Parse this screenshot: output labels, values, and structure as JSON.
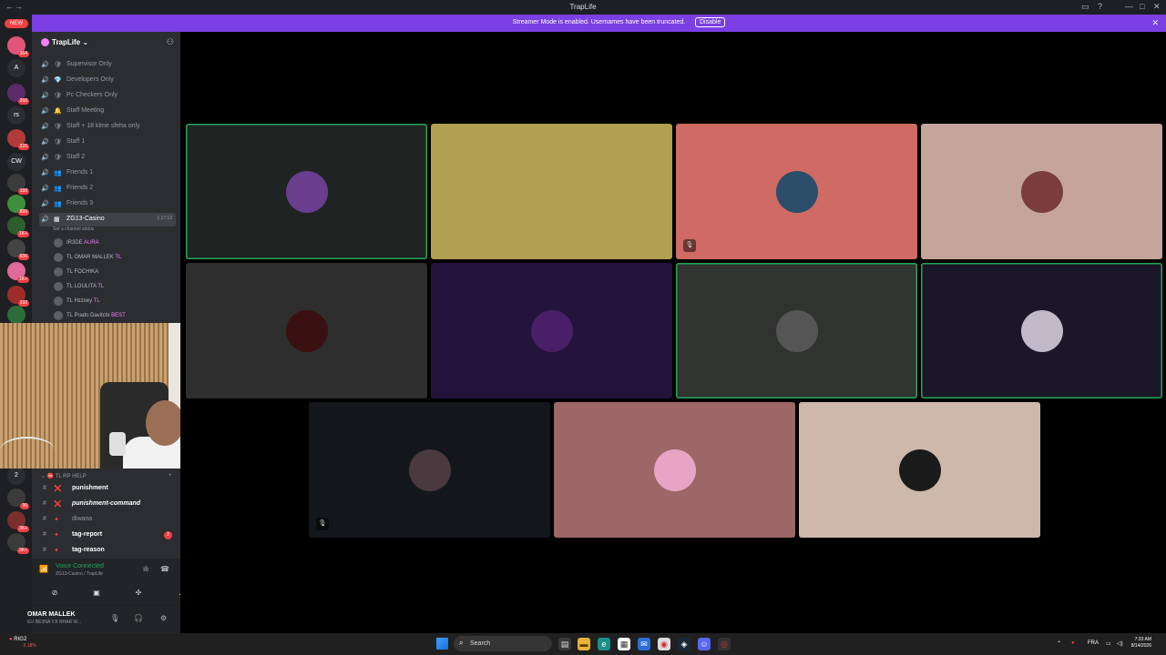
{
  "window": {
    "title": "TrapLife"
  },
  "streamer_banner": {
    "message": "Streamer Mode is enabled. Usernames have been truncated.",
    "disable_label": "Disable"
  },
  "servers": {
    "new_label": "NEW",
    "items": [
      {
        "label": "",
        "badge": "364",
        "color": "#e2547a"
      },
      {
        "label": "A",
        "badge": "",
        "color": "#2b2d31"
      },
      {
        "label": "",
        "badge": "268",
        "color": "#5c2a6b"
      },
      {
        "label": "rs",
        "badge": "",
        "color": "#2b2d31"
      },
      {
        "label": "",
        "badge": "226",
        "color": "#b33a3a"
      },
      {
        "label": "CW",
        "badge": "",
        "color": "#2b2d31"
      },
      {
        "label": "",
        "badge": "188",
        "color": "#3b3b3b"
      },
      {
        "label": "",
        "badge": "899",
        "color": "#3d8f3d"
      },
      {
        "label": "",
        "badge": "1K+",
        "color": "#2e5d2e"
      },
      {
        "label": "",
        "badge": "936",
        "color": "#444"
      },
      {
        "label": "",
        "badge": "1K+",
        "color": "#e06a9a"
      },
      {
        "label": "",
        "badge": "192",
        "color": "#a02b2b"
      },
      {
        "label": "",
        "badge": "",
        "color": "#2d6b3a"
      }
    ],
    "bottom_items": [
      {
        "label": "2",
        "badge": "",
        "color": "#2b2d31"
      },
      {
        "label": "",
        "badge": "90",
        "color": "#3b3b3b"
      },
      {
        "label": "",
        "badge": "3K+",
        "color": "#7a2f2f"
      },
      {
        "label": "",
        "badge": "3K+",
        "color": "#3b3b3b"
      }
    ]
  },
  "guild": {
    "name": "TrapLife",
    "voice_channels": [
      {
        "label": "Supervisor Only",
        "emoji": "shield-green-icon"
      },
      {
        "label": "Developers Only",
        "emoji": "diamond-icon"
      },
      {
        "label": "Pc Checkers Only",
        "emoji": "shield-green-icon"
      },
      {
        "label": "Staff Meeting",
        "emoji": "bell-icon"
      },
      {
        "label": "Staff + 18 klme sfeha only",
        "emoji": "shield-green-icon"
      },
      {
        "label": "Staff 1",
        "emoji": "shield-green-icon"
      },
      {
        "label": "Staff 2",
        "emoji": "shield-green-icon"
      },
      {
        "label": "Friends 1",
        "emoji": "group-icon"
      },
      {
        "label": "Friends 2",
        "emoji": "group-icon"
      },
      {
        "label": "Friends 3",
        "emoji": "group-icon"
      }
    ],
    "active_channel": {
      "label": "ZG13-Casino",
      "timer": "1:17:12",
      "status_placeholder": "Set a channel status"
    },
    "members": [
      {
        "name": "IR3DE",
        "tag": "AURA"
      },
      {
        "name": "TL OMAR MALLEK",
        "tag": "TL"
      },
      {
        "name": "TL FOCHIKA",
        "tag": ""
      },
      {
        "name": "TL LOULITA",
        "tag": "TL"
      },
      {
        "name": "TL Hzzxey",
        "tag": "TL"
      },
      {
        "name": "TL Prado Davitchi",
        "tag": "BEST"
      }
    ],
    "help_category": "TL RP HELP",
    "text_channels": [
      {
        "label": "punishment",
        "bold": true,
        "italic": false,
        "count": ""
      },
      {
        "label": "punishment-command",
        "bold": true,
        "italic": true,
        "count": ""
      },
      {
        "label": "diwana",
        "bold": false,
        "italic": false,
        "count": ""
      },
      {
        "label": "tag-report",
        "bold": true,
        "italic": false,
        "count": "2"
      },
      {
        "label": "tag-reason",
        "bold": true,
        "italic": false,
        "count": ""
      }
    ]
  },
  "voice_panel": {
    "status": "Voice Connected",
    "location": "ZG13-Casino / TrapLife"
  },
  "user_panel": {
    "name": "OMAR MALLEK",
    "status": "ELI BE3NA YJI NHAR W..."
  },
  "tiles": [
    {
      "bg": "#1f2423",
      "avatar": "#6a3d8f",
      "speaking": true
    },
    {
      "bg": "#b0a04f",
      "avatar": "#b0a04f",
      "speaking": false
    },
    {
      "bg": "#cf6a64",
      "avatar": "#2a4d6a",
      "speaking": false,
      "mic": true
    },
    {
      "bg": "#c5a59b",
      "avatar": "#7b3c3c",
      "speaking": false
    },
    {
      "bg": "#2e2e2e",
      "avatar": "#3a1010",
      "speaking": false
    },
    {
      "bg": "#24133a",
      "avatar": "#4a1f6a",
      "speaking": false
    },
    {
      "bg": "#313331",
      "avatar": "#555555",
      "speaking": true
    },
    {
      "bg": "#1c1728",
      "avatar": "#c0b9c8",
      "speaking": true
    },
    {
      "bg": "#13171b",
      "avatar": "#4a3a40",
      "speaking": false,
      "mic": true
    },
    {
      "bg": "#9c6766",
      "avatar": "#e8a4c4",
      "speaking": false
    },
    {
      "bg": "#cdb8ab",
      "avatar": "#1a1a1a",
      "speaking": false
    }
  ],
  "taskbar": {
    "weather": "RIG2",
    "weather_change": "-2.18%",
    "search_placeholder": "Search",
    "lang": "FRA",
    "time": "7:33 AM",
    "date": "8/14/2026"
  }
}
